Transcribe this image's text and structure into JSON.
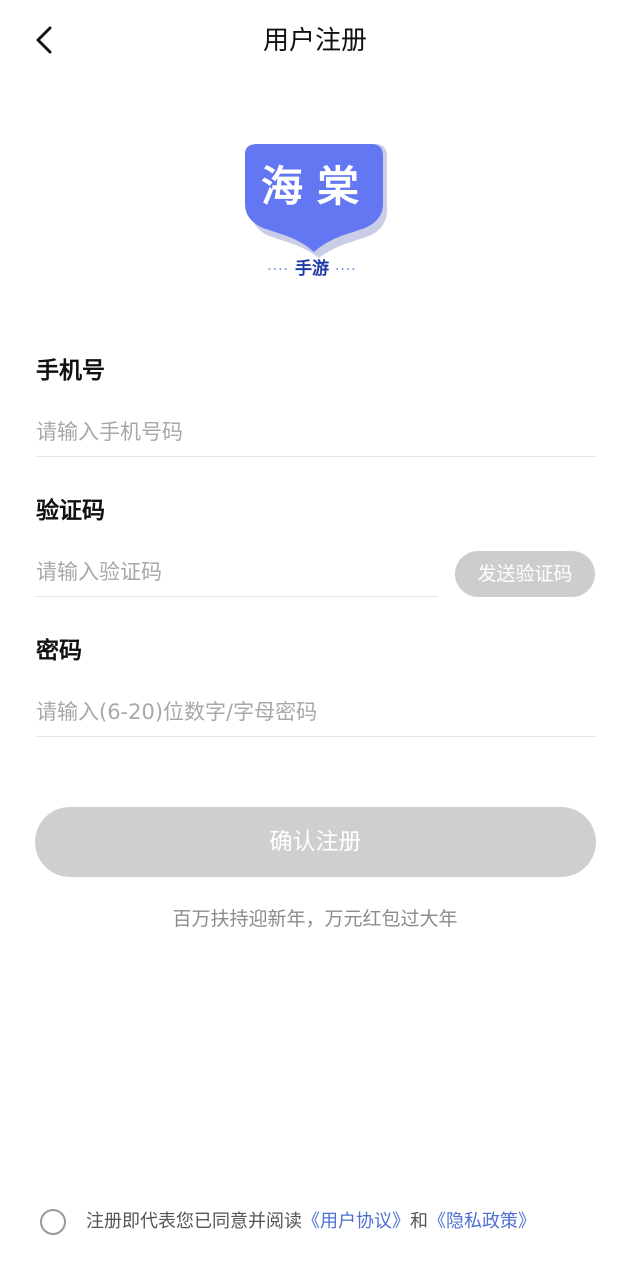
{
  "header": {
    "title": "用户注册",
    "back_icon": "chevron-left-icon"
  },
  "logo": {
    "main_text": "海棠",
    "sub_text": "手游",
    "sub_dots_left": "····",
    "sub_dots_right": "····",
    "colors": {
      "badge": "#6477f2",
      "badge_shadow": "#c9cde6",
      "sub_text": "#1e3ba8"
    }
  },
  "form": {
    "phone": {
      "label": "手机号",
      "placeholder": "请输入手机号码",
      "value": ""
    },
    "code": {
      "label": "验证码",
      "placeholder": "请输入验证码",
      "value": "",
      "send_button": "发送验证码"
    },
    "password": {
      "label": "密码",
      "placeholder": "请输入(6-20)位数字/字母密码",
      "value": ""
    },
    "submit_button": "确认注册"
  },
  "promo": {
    "text": "百万扶持迎新年，万元红包过大年"
  },
  "agreement": {
    "checked": false,
    "prefix": "注册即代表您已同意并阅读",
    "user_agreement": "《用户协议》",
    "conjunction": "和",
    "privacy_policy": "《隐私政策》"
  },
  "colors": {
    "link": "#4e6fd3",
    "disabled_button": "#cfcfcf",
    "placeholder": "#a8a8a8",
    "divider": "#e6e6e6"
  }
}
